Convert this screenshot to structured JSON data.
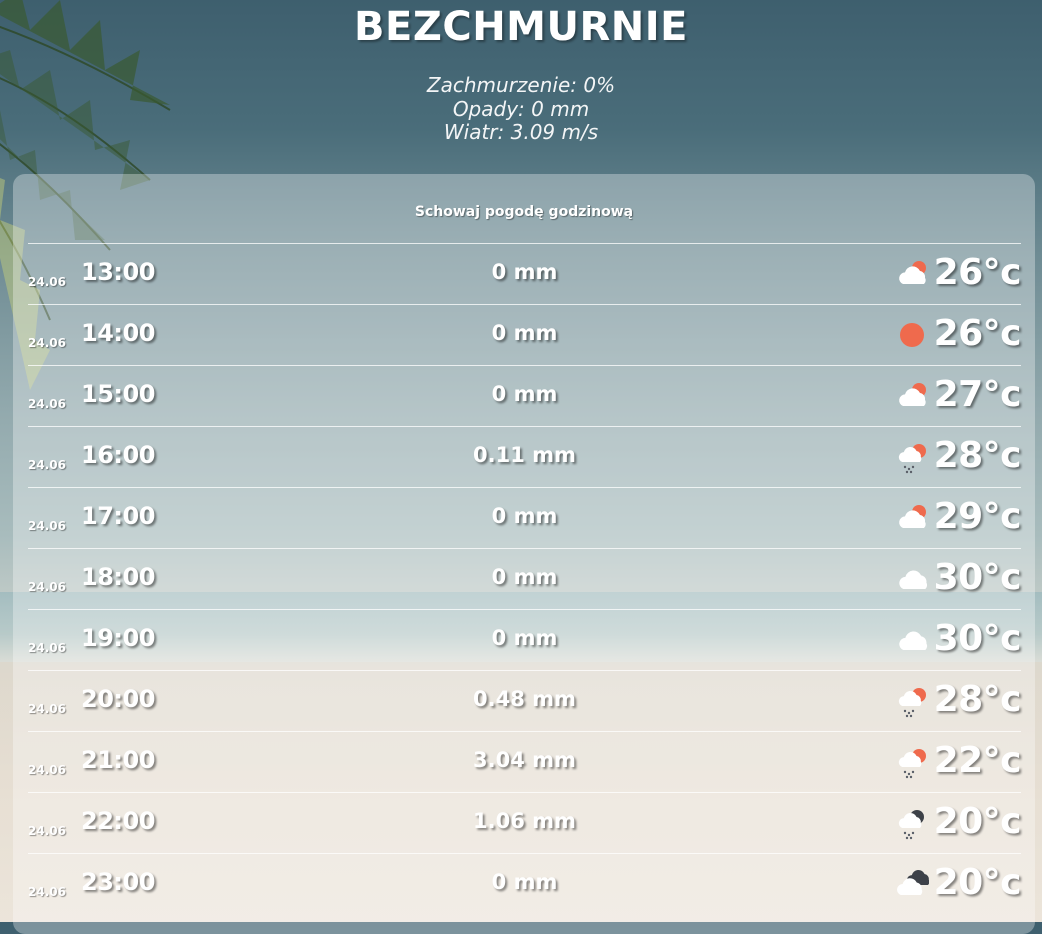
{
  "weather": {
    "title": "BEZCHMURNIE",
    "cloudiness": "Zachmurzenie: 0%",
    "precipitation": "Opady: 0 mm",
    "wind": "Wiatr: 3.09 m/s"
  },
  "hourly": {
    "toggle_label": "Schowaj pogodę godzinową",
    "rows": [
      {
        "date": "24.06",
        "hour": "13:00",
        "precip": "0 mm",
        "icon": "partly-cloudy-icon",
        "temp": "26°c"
      },
      {
        "date": "24.06",
        "hour": "14:00",
        "precip": "0 mm",
        "icon": "sun-icon",
        "temp": "26°c"
      },
      {
        "date": "24.06",
        "hour": "15:00",
        "precip": "0 mm",
        "icon": "partly-cloudy-icon",
        "temp": "27°c"
      },
      {
        "date": "24.06",
        "hour": "16:00",
        "precip": "0.11 mm",
        "icon": "sun-rain-icon",
        "temp": "28°c"
      },
      {
        "date": "24.06",
        "hour": "17:00",
        "precip": "0 mm",
        "icon": "partly-cloudy-icon",
        "temp": "29°c"
      },
      {
        "date": "24.06",
        "hour": "18:00",
        "precip": "0 mm",
        "icon": "cloud-icon",
        "temp": "30°c"
      },
      {
        "date": "24.06",
        "hour": "19:00",
        "precip": "0 mm",
        "icon": "cloud-icon",
        "temp": "30°c"
      },
      {
        "date": "24.06",
        "hour": "20:00",
        "precip": "0.48 mm",
        "icon": "sun-rain-icon",
        "temp": "28°c"
      },
      {
        "date": "24.06",
        "hour": "21:00",
        "precip": "3.04 mm",
        "icon": "sun-rain-icon",
        "temp": "22°c"
      },
      {
        "date": "24.06",
        "hour": "22:00",
        "precip": "1.06 mm",
        "icon": "dark-cloud-rain-icon",
        "temp": "20°c"
      },
      {
        "date": "24.06",
        "hour": "23:00",
        "precip": "0 mm",
        "icon": "dark-clouds-icon",
        "temp": "20°c"
      }
    ]
  },
  "colors": {
    "sun": "#ef6a4d",
    "cloud": "#ffffff",
    "dark_cloud": "#3d4148",
    "rain": "#5a5f68"
  }
}
